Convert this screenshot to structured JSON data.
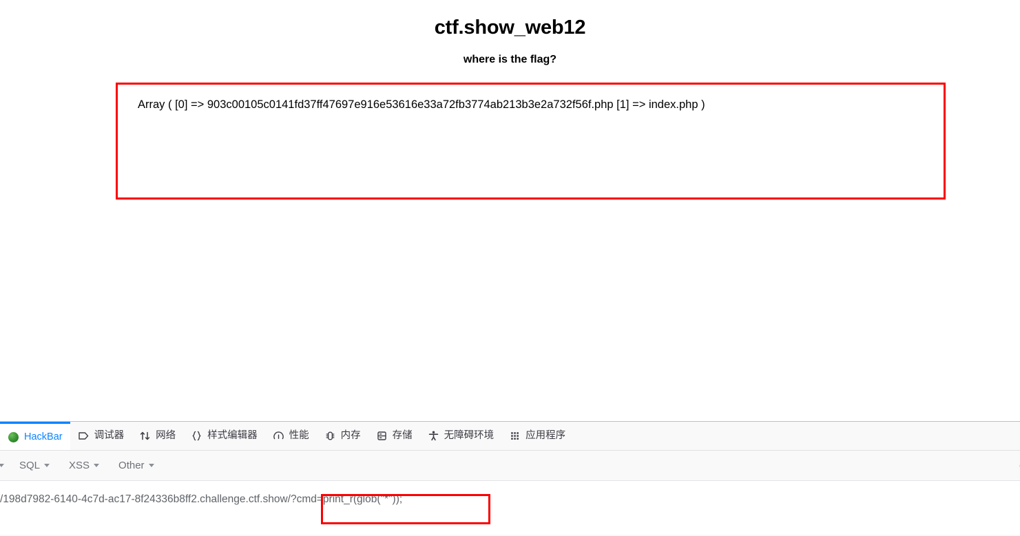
{
  "page": {
    "title": "ctf.show_web12",
    "subtitle": "where is the flag?",
    "result_text": "Array ( [0] => 903c00105c0141fd37ff47697e916e53616e33a72fb3774ab213b3e2a732f56f.php [1] => index.php )",
    "highlight_color": "#fb0000"
  },
  "devtools": {
    "accent_color": "#0a84ff",
    "tabs": [
      {
        "label": "HackBar",
        "icon": "hackbar-logo-icon",
        "active": true
      },
      {
        "label": "调试器",
        "icon": "debugger-icon",
        "active": false
      },
      {
        "label": "网络",
        "icon": "network-icon",
        "active": false
      },
      {
        "label": "样式编辑器",
        "icon": "style-editor-icon",
        "active": false
      },
      {
        "label": "性能",
        "icon": "performance-icon",
        "active": false
      },
      {
        "label": "内存",
        "icon": "memory-icon",
        "active": false
      },
      {
        "label": "存储",
        "icon": "storage-icon",
        "active": false
      },
      {
        "label": "无障碍环境",
        "icon": "accessibility-icon",
        "active": false
      },
      {
        "label": "应用程序",
        "icon": "application-icon",
        "active": false
      }
    ],
    "hackbar_toolbar": {
      "items": [
        {
          "label": "",
          "has_caret": true
        },
        {
          "label": "SQL",
          "has_caret": true
        },
        {
          "label": "XSS",
          "has_caret": true
        },
        {
          "label": "Other",
          "has_caret": true
        }
      ],
      "right_label": "Co"
    },
    "url": {
      "host_part": "/198d7982-6140-4c7d-ac17-8f24336b8ff2.challenge.ctf.show",
      "query_part": "/?cmd=print_r(glob(\"*\"));"
    }
  }
}
